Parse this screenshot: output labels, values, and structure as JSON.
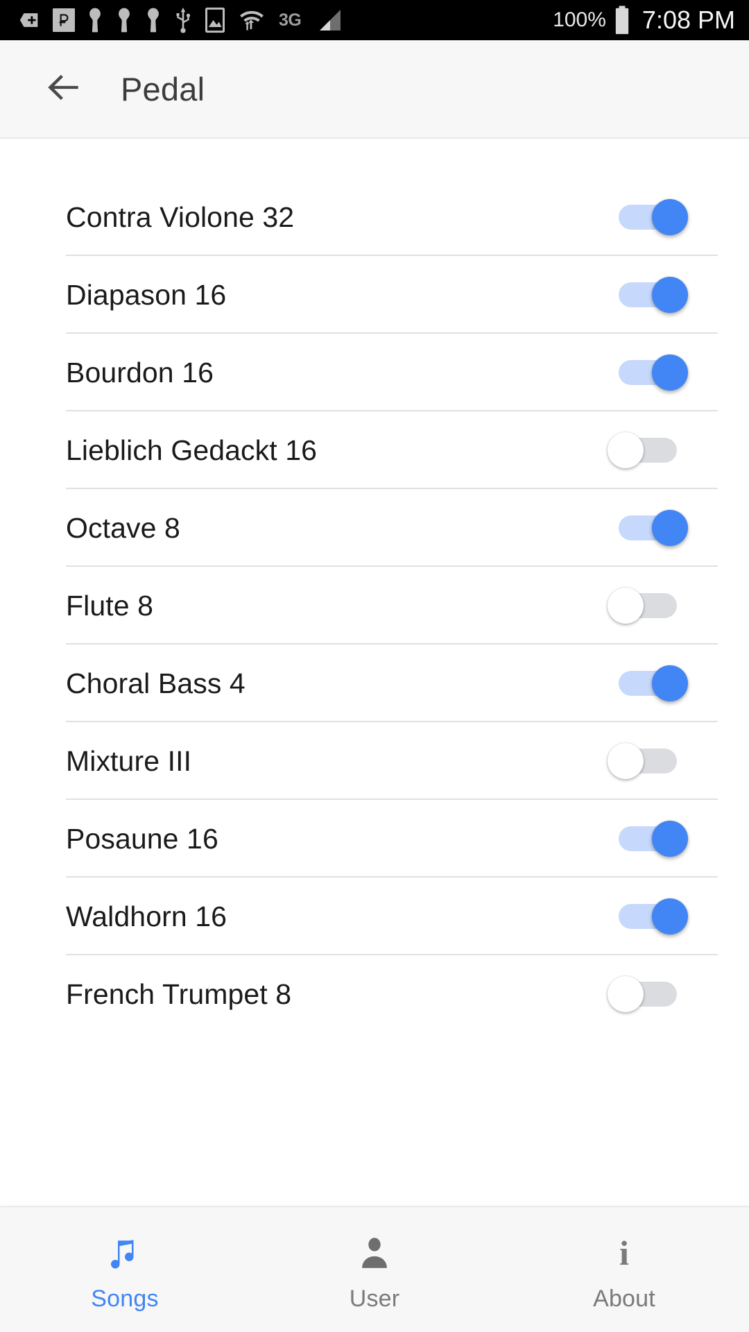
{
  "status_bar": {
    "icons": [
      "add-shape-icon",
      "pesos-badge-icon",
      "key-icon",
      "key-icon",
      "key-icon",
      "usb-icon",
      "image-icon",
      "wifi-data-icon"
    ],
    "network_type": "3G",
    "signal_icon": "signal-bars-icon",
    "battery_percent": "100%",
    "battery_icon": "battery-full-icon",
    "time": "7:08 PM"
  },
  "app_bar": {
    "back_icon": "arrow-back-icon",
    "title": "Pedal"
  },
  "stops": [
    {
      "name": "Contra Violone 32",
      "enabled": true
    },
    {
      "name": "Diapason 16",
      "enabled": true
    },
    {
      "name": "Bourdon 16",
      "enabled": true
    },
    {
      "name": "Lieblich Gedackt 16",
      "enabled": false
    },
    {
      "name": "Octave 8",
      "enabled": true
    },
    {
      "name": "Flute 8",
      "enabled": false
    },
    {
      "name": "Choral Bass 4",
      "enabled": true
    },
    {
      "name": "Mixture III",
      "enabled": false
    },
    {
      "name": "Posaune 16",
      "enabled": true
    },
    {
      "name": "Waldhorn 16",
      "enabled": true
    },
    {
      "name": "French Trumpet 8",
      "enabled": false
    }
  ],
  "bottom_nav": {
    "active_index": 0,
    "items": [
      {
        "label": "Songs",
        "icon": "music-note-icon",
        "active": true
      },
      {
        "label": "User",
        "icon": "person-icon",
        "active": false
      },
      {
        "label": "About",
        "icon": "info-icon",
        "active": false
      }
    ]
  },
  "colors": {
    "accent": "#4285f4",
    "switch_on_track": "#c6d8fb",
    "switch_off_track": "#dadce0",
    "app_bar_bg": "#f7f7f7",
    "status_bar_bg": "#000000",
    "divider": "#e0e0e0",
    "text_primary": "#1a1a1a",
    "text_secondary": "#7a7a7a"
  }
}
